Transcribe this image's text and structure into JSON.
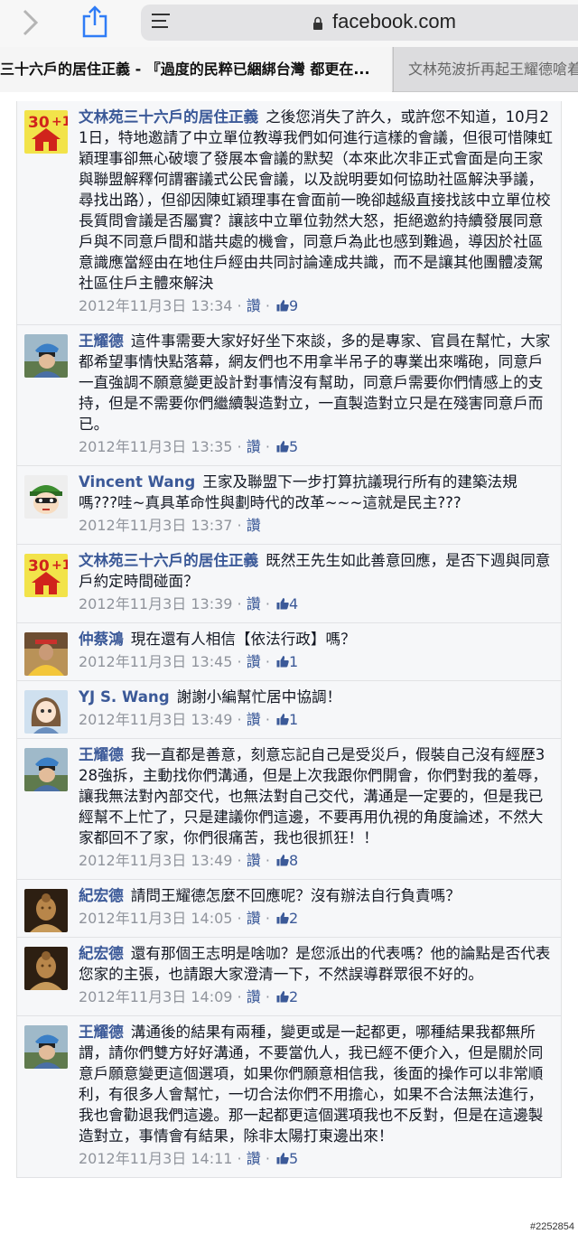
{
  "browser": {
    "url": "facebook.com",
    "tabs": [
      {
        "label": "三十六戶的居住正義 - 『過度的民粹已綑綁台灣 都更在..."
      },
      {
        "label": "文林苑波折再起王耀德嗆着"
      }
    ]
  },
  "comments": [
    {
      "author": "文林苑三十六戶的居住正義",
      "avatar": "badge-30plus-icon",
      "text": "之後您消失了許久，或許您不知道，10月21日，特地邀請了中立單位教導我們如何進行這樣的會議，但很可惜陳虹穎理事卻無心破壞了發展本會議的默契（本來此次非正式會面是向王家與聯盟解釋何謂審議式公民會議，以及說明要如何協助社區解決爭議，尋找出路），但卻因陳虹穎理事在會面前一晚卻越級直接找該中立單位校長質問會議是否屬實？讓該中立單位勃然大怒，拒絕邀約持續發展同意戶與不同意戶間和諧共處的機會，同意戶為此也感到難過，導因於社區意識應當經由在地住戶經由共同討論達成共識，而不是讓其他團體凌駕社區住戶主體來解決",
      "time": "2012年11月3日 13:34",
      "like_label": "讚",
      "likes": "9"
    },
    {
      "author": "王耀德",
      "avatar": "cyclist-photo",
      "text": "這件事需要大家好好坐下來談，多的是專家、官員在幫忙，大家都希望事情快點落幕，網友們也不用拿半吊子的專業出來嘴砲，同意戶一直強調不願意變更設計對事情沒有幫助，同意戶需要你們情感上的支持，但是不需要你們繼續製造對立，一直製造對立只是在殘害同意戶而已。",
      "time": "2012年11月3日 13:35",
      "like_label": "讚",
      "likes": "5"
    },
    {
      "author": "Vincent Wang",
      "avatar": "cartoon-helmet-avatar",
      "text": "王家及聯盟下一步打算抗議現行所有的建築法規嗎???哇~真具革命性與劃時代的改革~~~這就是民主???",
      "time": "2012年11月3日 13:37",
      "like_label": "讚",
      "likes": ""
    },
    {
      "author": "文林苑三十六戶的居住正義",
      "avatar": "badge-30plus-icon",
      "text": "既然王先生如此善意回應，是否下週與同意戶約定時間碰面？",
      "time": "2012年11月3日 13:39",
      "like_label": "讚",
      "likes": "4"
    },
    {
      "author": "仲蔡鴻",
      "avatar": "yellow-shirt-photo",
      "text": "現在還有人相信【依法行政】嗎？",
      "time": "2012年11月3日 13:45",
      "like_label": "讚",
      "likes": "1"
    },
    {
      "author": "YJ S. Wang",
      "avatar": "anime-girl-avatar",
      "text": "謝謝小編幫忙居中協調！",
      "time": "2012年11月3日 13:49",
      "like_label": "讚",
      "likes": "1"
    },
    {
      "author": "王耀德",
      "avatar": "cyclist-photo",
      "text": "我一直都是善意，刻意忘記自己是受災戶，假裝自己沒有經歷328強拆，主動找你們溝通，但是上次我跟你們開會，你們對我的羞辱，讓我無法對內部交代，也無法對自己交代，溝通是一定要的，但是我已經幫不上忙了，只是建議你們這邊，不要再用仇視的角度論述，不然大家都回不了家，你們很痛苦，我也很抓狂！！",
      "time": "2012年11月3日 13:49",
      "like_label": "讚",
      "likes": "8"
    },
    {
      "author": "紀宏德",
      "avatar": "buddha-statue-photo",
      "text": "請問王耀德怎麼不回應呢？沒有辦法自行負責嗎？",
      "time": "2012年11月3日 14:05",
      "like_label": "讚",
      "likes": "2"
    },
    {
      "author": "紀宏德",
      "avatar": "buddha-statue-photo",
      "text": "還有那個王志明是啥咖？是您派出的代表嗎？他的論點是否代表您家的主張，也請跟大家澄清一下，不然誤導群眾很不好的。",
      "time": "2012年11月3日 14:09",
      "like_label": "讚",
      "likes": "2"
    },
    {
      "author": "王耀德",
      "avatar": "cyclist-photo",
      "text": "溝通後的結果有兩種，變更或是一起都更，哪種結果我都無所謂，請你們雙方好好溝通，不要當仇人，我已經不便介入，但是關於同意戶願意變更這個選項，如果你們願意相信我，後面的操作可以非常順利，有很多人會幫忙，一切合法你們不用擔心，如果不合法無法進行，我也會勸退我們這邊。那一起都更這個選項我也不反對，但是在這邊製造對立，事情會有結果，除非太陽打東邊出來！",
      "time": "2012年11月3日 14:11",
      "like_label": "讚",
      "likes": "5"
    }
  ],
  "watermark": "#2252854"
}
